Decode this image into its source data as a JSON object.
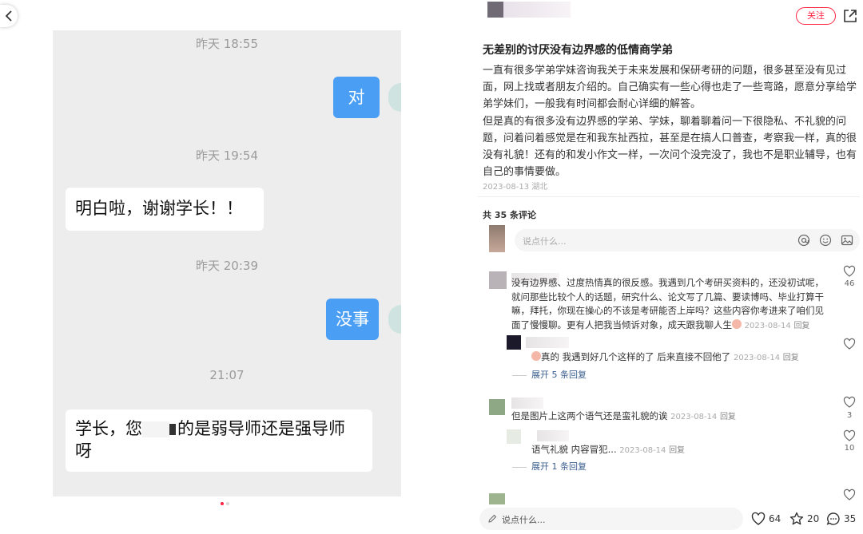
{
  "chat": {
    "messages": [
      {
        "time": "昨天 18:55",
        "text": "对",
        "from": "me"
      },
      {
        "time": "昨天 19:54",
        "text": "明白啦，谢谢学长！！",
        "from": "them"
      },
      {
        "time": "昨天 20:39",
        "text": "没事",
        "from": "me"
      },
      {
        "time": "21:07",
        "text_a": "学长，您",
        "text_b": "的是弱导师还是强导师",
        "text_c": "呀",
        "from": "them"
      }
    ]
  },
  "post": {
    "follow_label": "关注",
    "title": "无差别的讨厌没有边界感的低情商学弟",
    "paragraphs": [
      "一直有很多学弟学妹咨询我关于未来发展和保研考研的问题，很多甚至没有见过面，网上找或者朋友介绍的。自己确实有一些心得也走了一些弯路，愿意分享给学弟学妹们，一般我有时间都会耐心详细的解答。",
      "但是真的有很多没有边界感的学弟、学妹，聊着聊着问一下很隐私、不礼貌的问题，问着问着感觉是在和我东扯西拉，甚至是在搞人口普查，考察我一样，真的很没有礼貌！还有的和发小作文一样，一次问个没完没了，我也不是职业辅导，也有自己的事情要做。"
    ],
    "meta": "2023-08-13 湖北"
  },
  "comments": {
    "count_label": "共 35 条评论",
    "input_placeholder": "说点什么...",
    "items": [
      {
        "text": "没有边界感、过度热情真的很反感。我遇到几个考研买资料的，还没初试呢，就问那些比较个人的话题，研究什么、论文写了几篇、要读博吗、毕业打算干嘛，拜托，你现在操心的不该是考研能否上岸吗？这些内容你考进来了咱们见面了慢慢聊。更有人把我当倾诉对象，成天跟我聊人生",
        "date": "2023-08-14",
        "reply": "回复",
        "likes": "46",
        "sub": {
          "text": "真的 我遇到好几个这样的了 后来直接不回他了",
          "date": "2023-08-14",
          "reply": "回复"
        },
        "expand": "展开 5 条回复"
      },
      {
        "text": "但是图片上这两个语气还是蛮礼貌的诶",
        "date": "2023-08-14",
        "reply": "回复",
        "likes": "3",
        "sub": {
          "text": "语气礼貌 内容冒犯...",
          "date": "2023-08-14",
          "reply": "回复",
          "likes": "10"
        },
        "expand": "展开 1 条回复"
      }
    ]
  },
  "bottom_bar": {
    "placeholder": "说点什么...",
    "likes": "64",
    "favorites": "20",
    "comments": "35"
  },
  "colors": {
    "accent": "#ff2442",
    "chat_bubble_me": "#4a9ff5",
    "chat_bg": "#ededed"
  }
}
